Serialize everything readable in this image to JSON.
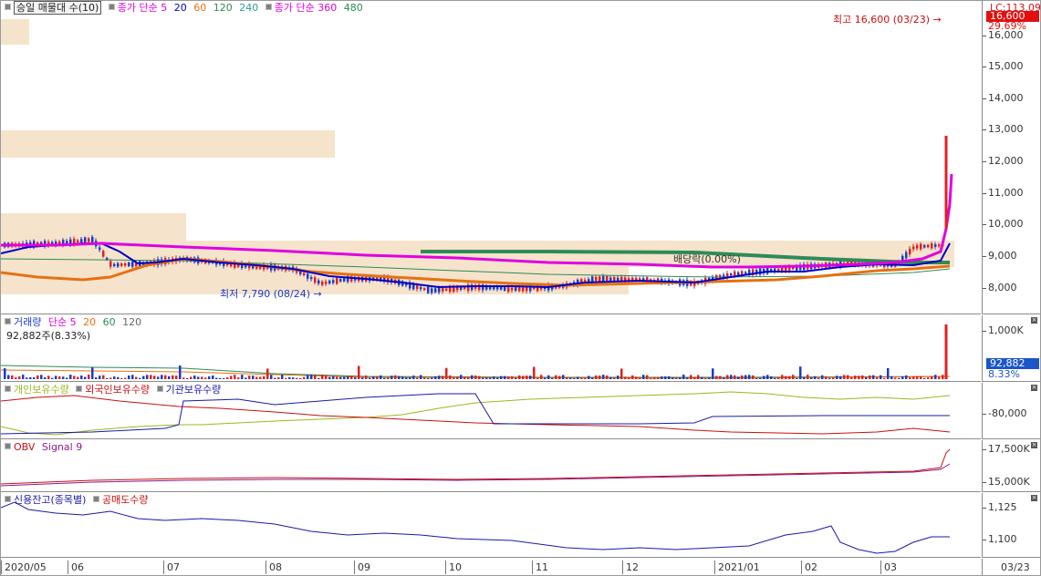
{
  "price_pane": {
    "legend": {
      "main_label": "승일 매물대 수(10)",
      "ma_label": "종가 단순 5",
      "ma_periods": [
        "20",
        "60",
        "120",
        "240"
      ],
      "ma2_label": "종가 단순 360",
      "ma2_period": "480"
    },
    "y_ticks": [
      "16,000",
      "15,000",
      "14,000",
      "13,000",
      "12,000",
      "11,000",
      "10,000",
      "9,000",
      "8,000"
    ],
    "current_tag": "LC:113.09",
    "current_price": "16,600",
    "current_pct": "29.69%",
    "high_annotation": "최고 16,600 (03/23)",
    "low_annotation": "최저 7,790 (08/24)",
    "dividend_annotation": "배당락(0.00%)"
  },
  "volume_pane": {
    "legend": {
      "main_label": "거래량",
      "ma_label": "단순 5",
      "periods": [
        "20",
        "60",
        "120"
      ]
    },
    "sub_label": "92,882주(8.33%)",
    "y_ticks": [
      "1,000K"
    ],
    "current_value": "92,882",
    "current_pct": "8.33%"
  },
  "holding_pane": {
    "legend": [
      "개인보유수량",
      "외국인보유수량",
      "기관보유수량"
    ],
    "y_ticks": [
      "-80,000"
    ]
  },
  "obv_pane": {
    "legend": {
      "main_label": "OBV",
      "signal_label": "Signal 9"
    },
    "y_ticks": [
      "17,500K",
      "15,000K"
    ]
  },
  "credit_pane": {
    "legend": [
      "신용잔고(종목별)",
      "공매도수량"
    ],
    "y_ticks": [
      "1,125",
      "1,100"
    ]
  },
  "x_axis": {
    "labels": [
      "2020/05",
      "06",
      "07",
      "08",
      "09",
      "10",
      "11",
      "12",
      "2021/01",
      "02",
      "03"
    ],
    "right_label": "03/23"
  },
  "colors": {
    "ma5": "#e000e0",
    "ma20": "#0000c8",
    "ma60": "#e87010",
    "ma120": "#2e8b57",
    "up": "#e02020",
    "down": "#1a3cc8",
    "volume_zone": "#f5e3cc",
    "price_tag": "#e01010"
  },
  "chart_data": [
    {
      "type": "line",
      "title": "승일 매물대 수(10)",
      "x": [
        "2020/05",
        "06",
        "07",
        "08",
        "09",
        "10",
        "11",
        "12",
        "2021/01",
        "02",
        "03",
        "03/23"
      ],
      "series": [
        {
          "name": "종가 단순 5",
          "values": [
            9300,
            9400,
            9000,
            8700,
            8200,
            8000,
            8000,
            8200,
            8300,
            8800,
            9000,
            11500
          ]
        },
        {
          "name": "20",
          "values": [
            9000,
            9300,
            9000,
            8800,
            8400,
            8100,
            8000,
            8200,
            8300,
            8700,
            8900,
            9400
          ]
        },
        {
          "name": "60",
          "values": [
            8500,
            8300,
            8900,
            8800,
            8500,
            8300,
            8100,
            8200,
            8200,
            8400,
            8600,
            8800
          ]
        },
        {
          "name": "120",
          "values": [
            8900,
            8900,
            8900,
            8900,
            9150,
            9150,
            9150,
            9100,
            9000,
            8900,
            8850,
            8850
          ]
        }
      ],
      "ylim": [
        7500,
        16500
      ],
      "high": {
        "value": 16600,
        "date": "03/23"
      },
      "low": {
        "value": 7790,
        "date": "08/24"
      }
    },
    {
      "type": "bar",
      "title": "거래량",
      "current": 92882,
      "ylim": [
        0,
        1000000
      ]
    }
  ]
}
